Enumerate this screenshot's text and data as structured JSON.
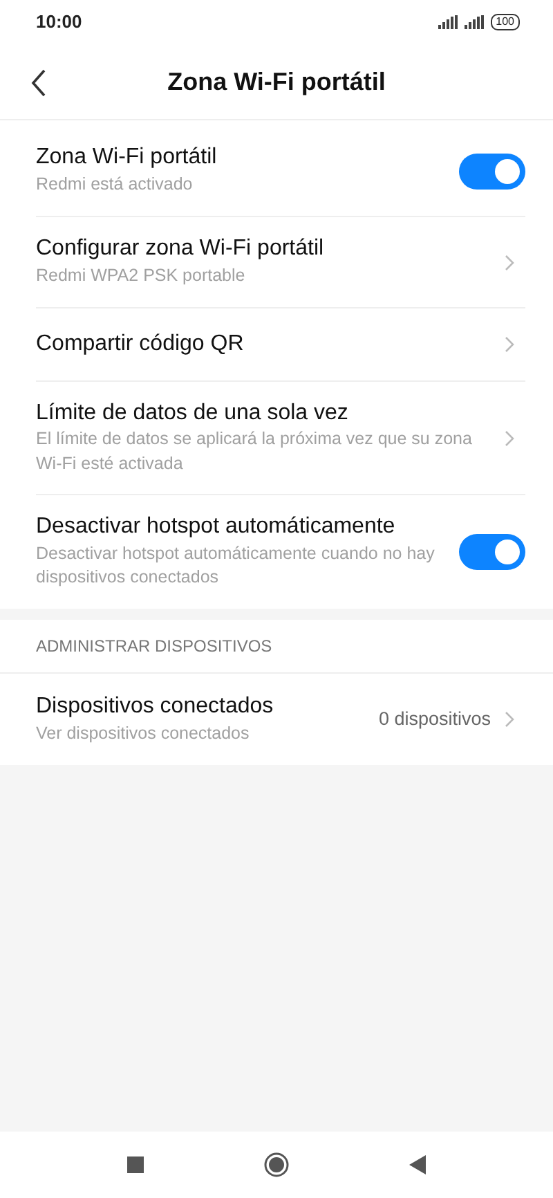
{
  "status_bar": {
    "time": "10:00",
    "battery": "100"
  },
  "header": {
    "title": "Zona Wi-Fi portátil"
  },
  "items": [
    {
      "kind": "switch",
      "title": "Zona Wi-Fi portátil",
      "subtitle": "Redmi está activado",
      "on": true
    },
    {
      "kind": "link",
      "title": "Configurar zona Wi-Fi portátil",
      "subtitle": "Redmi WPA2 PSK portable"
    },
    {
      "kind": "link",
      "title": "Compartir código QR"
    },
    {
      "kind": "link",
      "title": "Límite de datos de una sola vez",
      "subtitle": "El límite de datos se aplicará la próxima vez que su zona Wi-Fi esté activada"
    },
    {
      "kind": "switch",
      "title": "Desactivar hotspot automáticamente",
      "subtitle": "Desactivar hotspot automáticamente cuando no hay dispositivos conectados",
      "on": true
    }
  ],
  "section": {
    "title": "ADMINISTRAR DISPOSITIVOS",
    "items": [
      {
        "kind": "link",
        "title": "Dispositivos conectados",
        "subtitle": "Ver dispositivos conectados",
        "value": "0 dispositivos"
      }
    ]
  }
}
